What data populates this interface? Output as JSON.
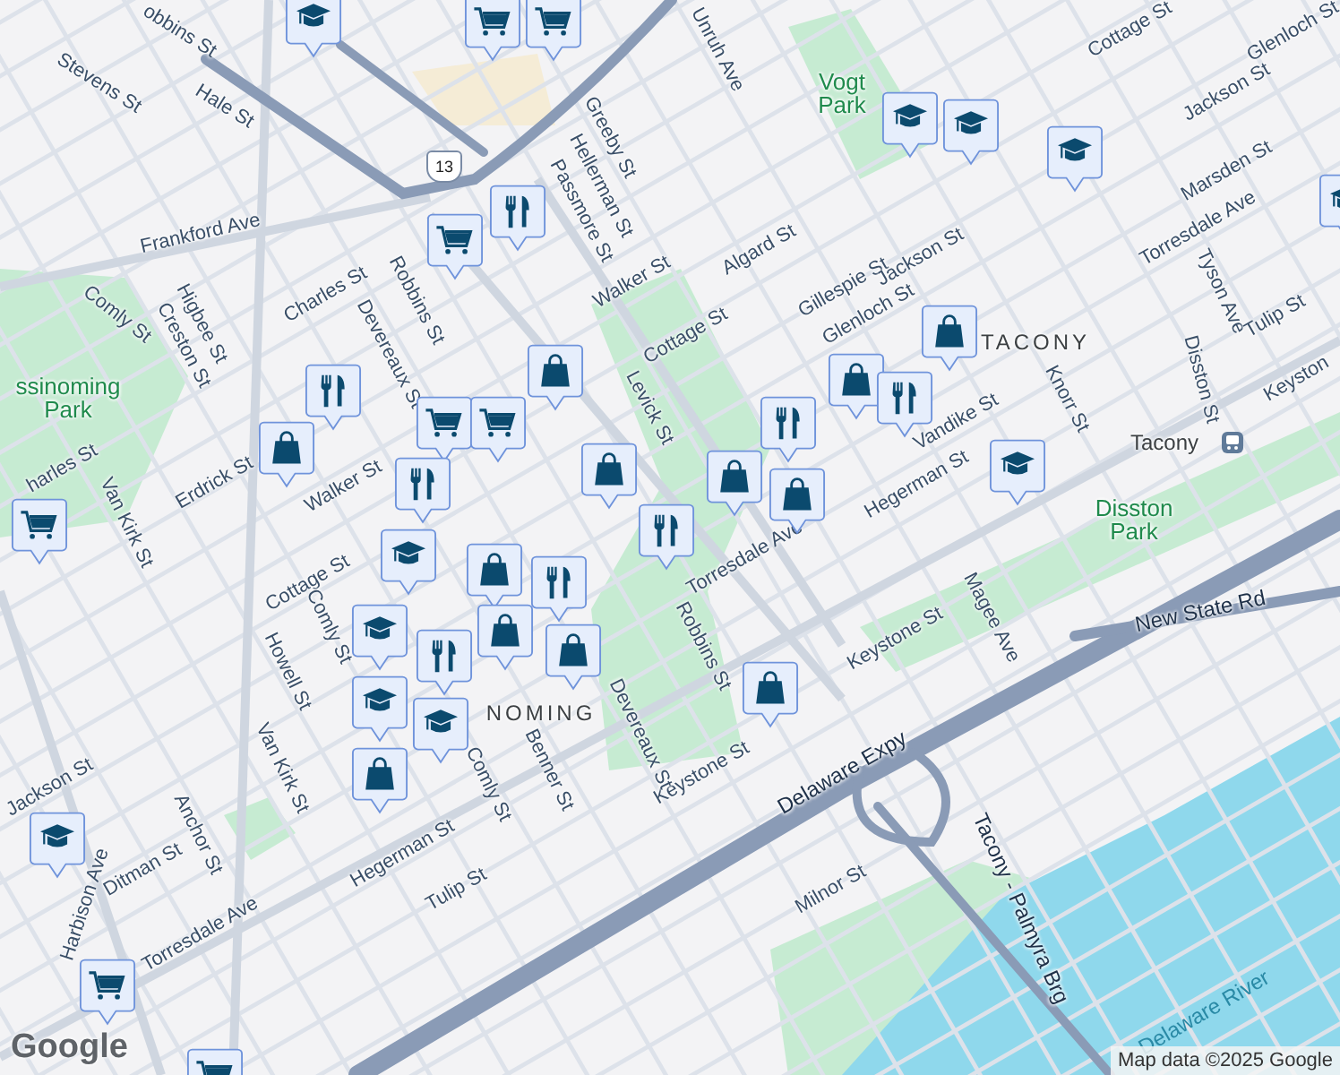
{
  "map": {
    "labels": [
      {
        "text": "obbins St",
        "kind": "street"
      },
      {
        "text": "Stevens St",
        "kind": "street"
      },
      {
        "text": "Hale St",
        "kind": "street"
      },
      {
        "text": "Frankford Ave",
        "kind": "street"
      },
      {
        "text": "Comly St",
        "kind": "street"
      },
      {
        "text": "Higbee St",
        "kind": "street"
      },
      {
        "text": "Creston St",
        "kind": "street"
      },
      {
        "text": "Charles St",
        "kind": "street"
      },
      {
        "text": "Devereaux St",
        "kind": "street"
      },
      {
        "text": "Robbins St",
        "kind": "street"
      },
      {
        "text": "Greeby St",
        "kind": "street"
      },
      {
        "text": "Hellerman St",
        "kind": "street"
      },
      {
        "text": "Passmore St",
        "kind": "street"
      },
      {
        "text": "Walker St",
        "kind": "street"
      },
      {
        "text": "Levick St",
        "kind": "street"
      },
      {
        "text": "Cottage St",
        "kind": "street"
      },
      {
        "text": "Algard St",
        "kind": "street"
      },
      {
        "text": "Gillespie St",
        "kind": "street"
      },
      {
        "text": "Jackson St",
        "kind": "street"
      },
      {
        "text": "Unruh Ave",
        "kind": "street"
      },
      {
        "text": "Glenloch St",
        "kind": "street"
      },
      {
        "text": "Torresdale Ave",
        "kind": "street"
      },
      {
        "text": "Torresdale Ave",
        "kind": "street"
      },
      {
        "text": "Vandike St",
        "kind": "street"
      },
      {
        "text": "Hegerman St",
        "kind": "street"
      },
      {
        "text": "Knorr St",
        "kind": "street"
      },
      {
        "text": "Disston St",
        "kind": "street"
      },
      {
        "text": "Tyson Ave",
        "kind": "street"
      },
      {
        "text": "Tulip St",
        "kind": "street"
      },
      {
        "text": "Marsden St",
        "kind": "street"
      },
      {
        "text": "Jackson St",
        "kind": "street"
      },
      {
        "text": "Cottage St",
        "kind": "street"
      },
      {
        "text": "Glenloch St",
        "kind": "street"
      },
      {
        "text": "Keyston",
        "kind": "street"
      },
      {
        "text": "Magee Ave",
        "kind": "street"
      },
      {
        "text": "Keystone St",
        "kind": "street"
      },
      {
        "text": "Keystone St",
        "kind": "street"
      },
      {
        "text": "Robbins St",
        "kind": "street"
      },
      {
        "text": "New State Rd",
        "kind": "highway"
      },
      {
        "text": "Delaware Expy",
        "kind": "highway"
      },
      {
        "text": "Tacony - Palmyra Brg",
        "kind": "highway"
      },
      {
        "text": "Milnor St",
        "kind": "street"
      },
      {
        "text": "Benner St",
        "kind": "street"
      },
      {
        "text": "Devereaux St",
        "kind": "street"
      },
      {
        "text": "Comly St",
        "kind": "street"
      },
      {
        "text": "Hegerman St",
        "kind": "street"
      },
      {
        "text": "Tulip St",
        "kind": "street"
      },
      {
        "text": "Torresdale Ave",
        "kind": "street"
      },
      {
        "text": "Ditman St",
        "kind": "street"
      },
      {
        "text": "Anchor St",
        "kind": "street"
      },
      {
        "text": "Van Kirk St",
        "kind": "street"
      },
      {
        "text": "Howell St",
        "kind": "street"
      },
      {
        "text": "Cottage St",
        "kind": "street"
      },
      {
        "text": "Comly St",
        "kind": "street"
      },
      {
        "text": "Van Kirk St",
        "kind": "street"
      },
      {
        "text": "Erdrick St",
        "kind": "street"
      },
      {
        "text": "Walker St",
        "kind": "street"
      },
      {
        "text": "harles St",
        "kind": "street"
      },
      {
        "text": "Harbison Ave",
        "kind": "street"
      },
      {
        "text": "Jackson St",
        "kind": "street"
      },
      {
        "text": "Vogt Park",
        "kind": "park"
      },
      {
        "text": "ssinoming Park",
        "kind": "park"
      },
      {
        "text": "Disston Park",
        "kind": "park"
      },
      {
        "text": "TACONY",
        "kind": "neighborhood"
      },
      {
        "text": "NOMING",
        "kind": "neighborhood"
      },
      {
        "text": "Tacony",
        "kind": "station"
      },
      {
        "text": "Delaware River",
        "kind": "water"
      }
    ],
    "route_shield": "13",
    "pins": [
      {
        "kind": "school"
      },
      {
        "kind": "grocery"
      },
      {
        "kind": "grocery"
      },
      {
        "kind": "restaurant"
      },
      {
        "kind": "grocery"
      },
      {
        "kind": "shop"
      },
      {
        "kind": "restaurant"
      },
      {
        "kind": "grocery"
      },
      {
        "kind": "grocery"
      },
      {
        "kind": "shop"
      },
      {
        "kind": "restaurant"
      },
      {
        "kind": "school"
      },
      {
        "kind": "shop"
      },
      {
        "kind": "restaurant"
      },
      {
        "kind": "shop"
      },
      {
        "kind": "restaurant"
      },
      {
        "kind": "restaurant"
      },
      {
        "kind": "shop"
      },
      {
        "kind": "shop"
      },
      {
        "kind": "school"
      },
      {
        "kind": "shop"
      },
      {
        "kind": "shop"
      },
      {
        "kind": "restaurant"
      },
      {
        "kind": "school"
      },
      {
        "kind": "school"
      },
      {
        "kind": "shop"
      },
      {
        "kind": "school"
      },
      {
        "kind": "school"
      },
      {
        "kind": "school"
      },
      {
        "kind": "school"
      },
      {
        "kind": "shop"
      },
      {
        "kind": "shop"
      },
      {
        "kind": "restaurant"
      },
      {
        "kind": "school"
      },
      {
        "kind": "shop"
      },
      {
        "kind": "school"
      },
      {
        "kind": "grocery"
      },
      {
        "kind": "grocery"
      },
      {
        "kind": "grocery"
      }
    ],
    "logo": "Google",
    "attribution": "Map data ©2025 Google"
  }
}
